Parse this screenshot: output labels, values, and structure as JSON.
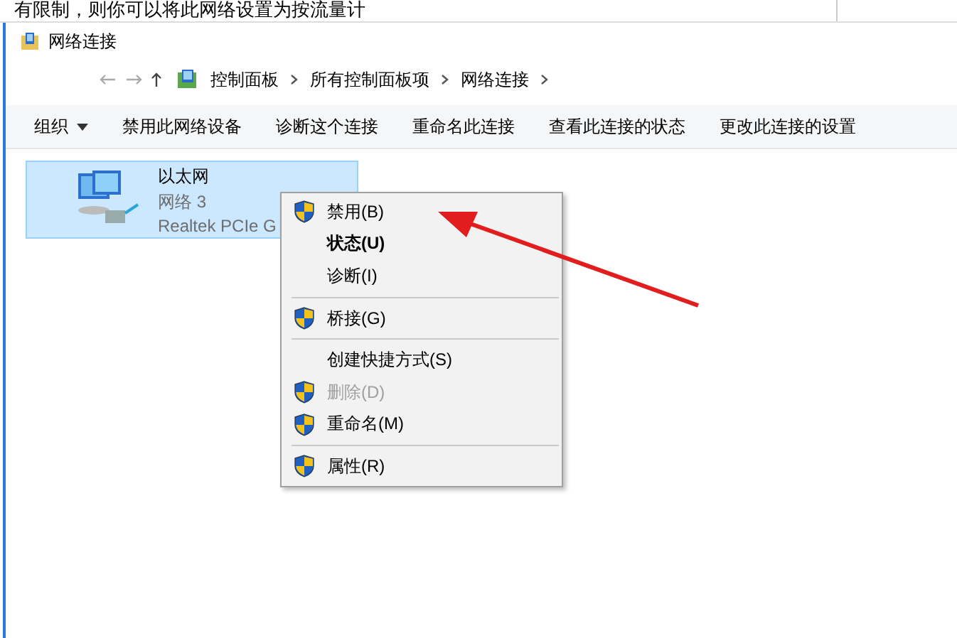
{
  "background_text": "有限制，则你可以将此网络设置为按流量计",
  "window": {
    "title": "网络连接"
  },
  "address_bar": {
    "crumbs": [
      "控制面板",
      "所有控制面板项",
      "网络连接"
    ]
  },
  "toolbar": [
    {
      "label": "组织",
      "dropdown": true
    },
    {
      "label": "禁用此网络设备",
      "dropdown": false
    },
    {
      "label": "诊断这个连接",
      "dropdown": false
    },
    {
      "label": "重命名此连接",
      "dropdown": false
    },
    {
      "label": "查看此连接的状态",
      "dropdown": false
    },
    {
      "label": "更改此连接的设置",
      "dropdown": false
    }
  ],
  "connections": [
    {
      "name": "以太网",
      "network": "网络  3",
      "adapter": "Realtek PCIe G",
      "selected": true
    }
  ],
  "context_menu": [
    {
      "kind": "item",
      "label": "禁用(B)",
      "shield": true,
      "bold": false,
      "disabled": false
    },
    {
      "kind": "item",
      "label": "状态(U)",
      "shield": false,
      "bold": true,
      "disabled": false
    },
    {
      "kind": "item",
      "label": "诊断(I)",
      "shield": false,
      "bold": false,
      "disabled": false
    },
    {
      "kind": "separator"
    },
    {
      "kind": "item",
      "label": "桥接(G)",
      "shield": true,
      "bold": false,
      "disabled": false
    },
    {
      "kind": "separator"
    },
    {
      "kind": "item",
      "label": "创建快捷方式(S)",
      "shield": false,
      "bold": false,
      "disabled": false
    },
    {
      "kind": "item",
      "label": "删除(D)",
      "shield": true,
      "bold": false,
      "disabled": true
    },
    {
      "kind": "item",
      "label": "重命名(M)",
      "shield": true,
      "bold": false,
      "disabled": false
    },
    {
      "kind": "separator"
    },
    {
      "kind": "item",
      "label": "属性(R)",
      "shield": true,
      "bold": false,
      "disabled": false
    }
  ]
}
